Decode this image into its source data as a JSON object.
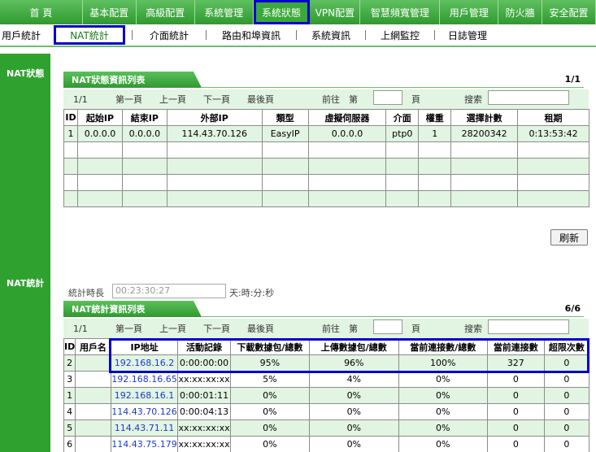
{
  "topnav": [
    "首 頁",
    "基本配置",
    "高級配置",
    "系統管理",
    "系統狀態",
    "VPN配置",
    "智慧頻寬管理",
    "用戶管理",
    "防火牆",
    "安全配置"
  ],
  "subnav": [
    "用戶統計",
    "NAT統計",
    "介面統計",
    "路由和埠資訊",
    "系統資訊",
    "上網監控",
    "日誌管理"
  ],
  "sidebar": {
    "nat_status": "NAT狀態",
    "nat_stats": "NAT統計"
  },
  "nat_status": {
    "title": "NAT狀態資訊列表",
    "page_count": "1/1",
    "pager": {
      "page": "1/1",
      "first": "第一頁",
      "prev": "上一頁",
      "next": "下一頁",
      "last": "最後頁",
      "goto": "前往",
      "nth": "第",
      "unit": "頁",
      "search": "搜索"
    },
    "columns": [
      "ID",
      "起始IP",
      "結束IP",
      "外部IP",
      "類型",
      "虛擬伺服器",
      "介面",
      "權重",
      "選擇計數",
      "租期"
    ],
    "rows": [
      [
        "1",
        "0.0.0.0",
        "0.0.0.0",
        "114.43.70.126",
        "EasyIP",
        "0.0.0.0",
        "ptp0",
        "1",
        "28200342",
        "0:13:53:42"
      ]
    ],
    "refresh": "刷新"
  },
  "nat_stats": {
    "duration_label": "統計時長",
    "duration_value": "00:23:30:27",
    "duration_unit": "天:時:分:秒",
    "title": "NAT統計資訊列表",
    "page_count": "6/6",
    "pager": {
      "page": "1/1",
      "first": "第一頁",
      "prev": "上一頁",
      "next": "下一頁",
      "last": "最後頁",
      "goto": "前往",
      "nth": "第",
      "unit": "頁",
      "search": "搜索"
    },
    "columns": [
      "ID",
      "用戶名",
      "IP地址",
      "活動記錄",
      "下載數據包/總數",
      "上傳數據包/總數",
      "當前連接數/總數",
      "當前連接數",
      "超限次數"
    ],
    "rows": [
      [
        "2",
        "",
        "192.168.16.2",
        "0:00:00:00",
        "95%",
        "96%",
        "100%",
        "327",
        "0"
      ],
      [
        "3",
        "",
        "192.168.16.65",
        "xx:xx:xx:xx",
        "5%",
        "4%",
        "0%",
        "0",
        "0"
      ],
      [
        "1",
        "",
        "192.168.16.1",
        "0:00:01:11",
        "0%",
        "0%",
        "0%",
        "0",
        "0"
      ],
      [
        "4",
        "",
        "114.43.70.126",
        "0:00:04:13",
        "0%",
        "0%",
        "0%",
        "0",
        "0"
      ],
      [
        "5",
        "",
        "114.43.71.11",
        "xx:xx:xx:xx",
        "0%",
        "0%",
        "0%",
        "0",
        "0"
      ],
      [
        "6",
        "",
        "114.43.75.179",
        "xx:xx:xx:xx",
        "0%",
        "0%",
        "0%",
        "0",
        "0"
      ]
    ]
  },
  "colors": {
    "nav_green": "#2f9a2f",
    "row_green": "#e2f4e2",
    "highlight_blue": "#0000cc",
    "link_blue": "#1a3ccc"
  }
}
